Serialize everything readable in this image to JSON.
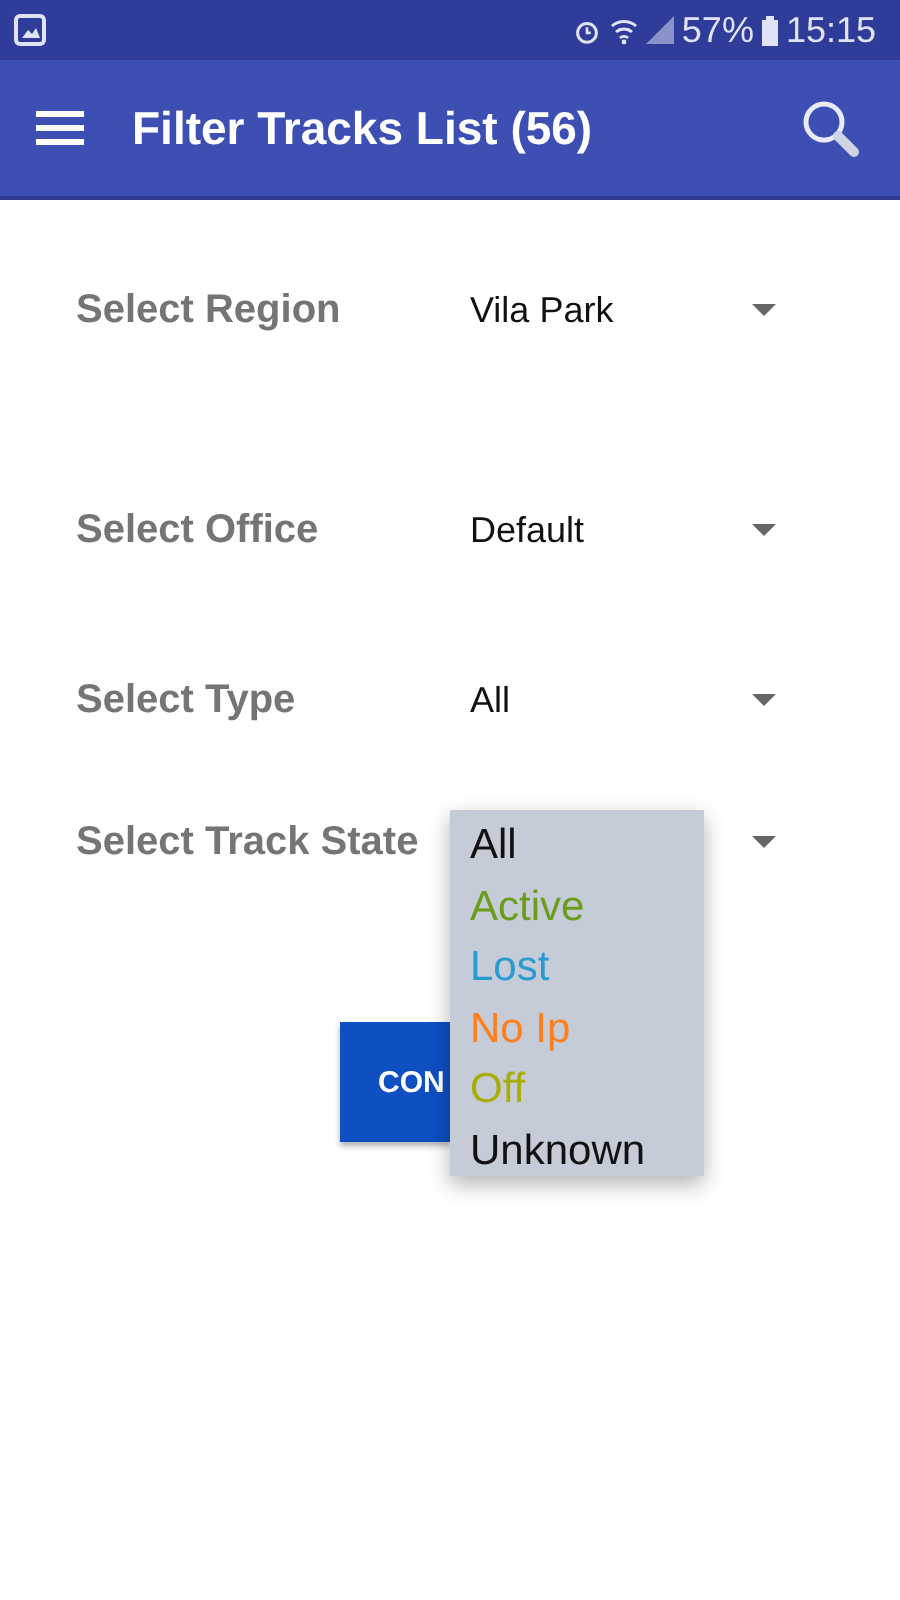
{
  "status_bar": {
    "battery": "57%",
    "time": "15:15"
  },
  "toolbar": {
    "title": "Filter Tracks List (56)"
  },
  "filters": [
    {
      "label": "Select Region",
      "value": "Vila Park"
    },
    {
      "label": "Select Office",
      "value": "Default"
    },
    {
      "label": "Select Type",
      "value": "All"
    },
    {
      "label": "Select Track State"
    }
  ],
  "confirm_button": {
    "label": "CON"
  },
  "dropdown": {
    "options": [
      {
        "label": "All",
        "color": "#111111"
      },
      {
        "label": "Active",
        "color": "#6a9e1a"
      },
      {
        "label": "Lost",
        "color": "#2a9bd0"
      },
      {
        "label": "No Ip",
        "color": "#ff7f1a"
      },
      {
        "label": "Off",
        "color": "#a8ad00"
      },
      {
        "label": "Unknown",
        "color": "#111111"
      }
    ]
  }
}
